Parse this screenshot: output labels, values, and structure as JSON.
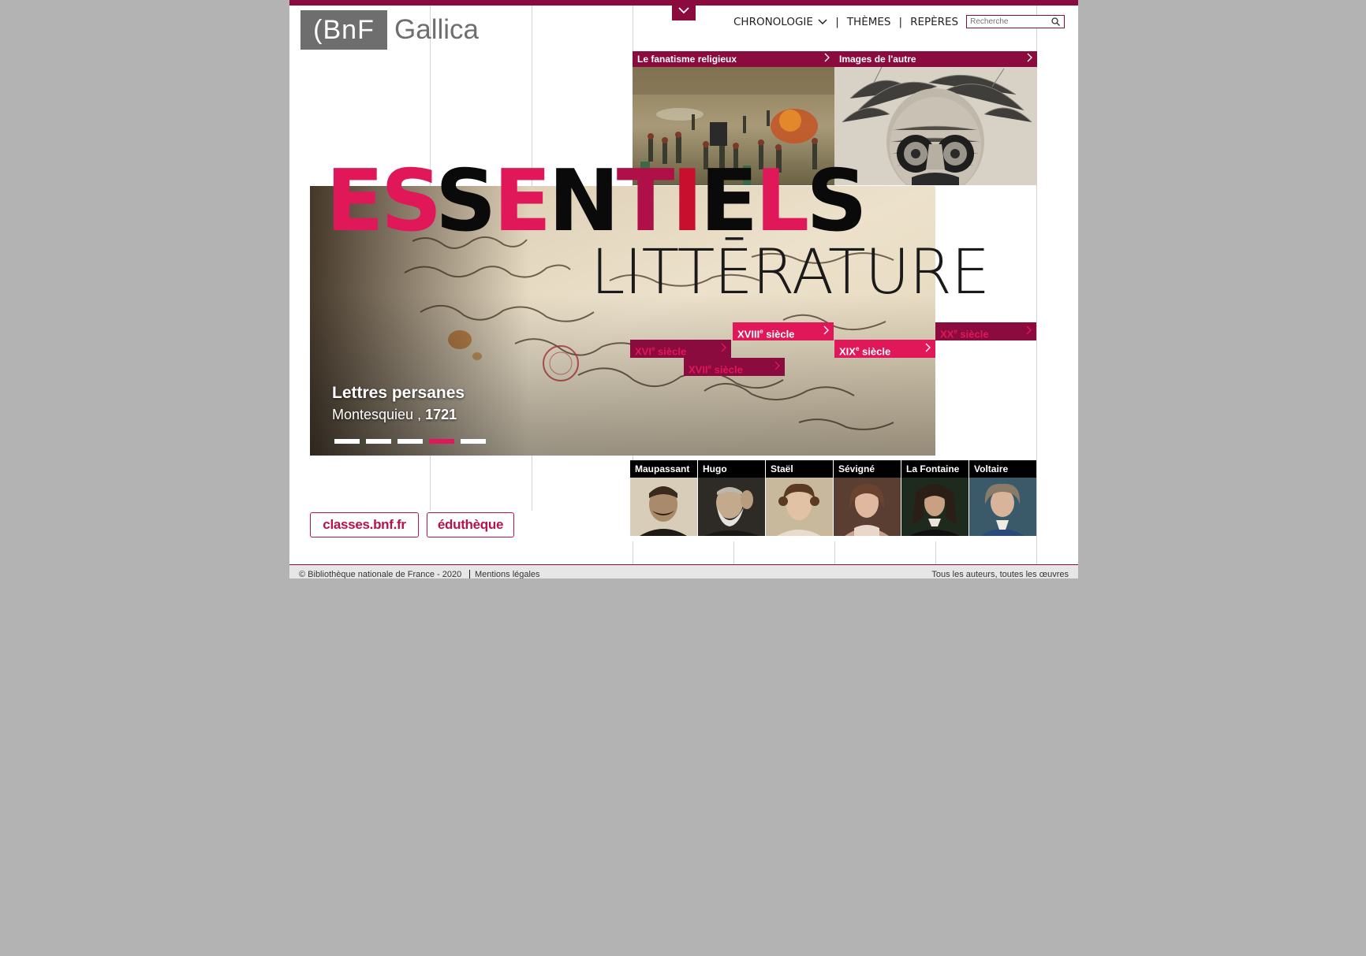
{
  "header": {
    "logo_bnf": "(BnF",
    "logo_gallica": "Gallica",
    "nav": {
      "chronologie": "CHRONOLOGIE",
      "themes": "THÈMES",
      "reperes": "REPÈRES",
      "separator": "|"
    },
    "search": {
      "placeholder": "Recherche"
    }
  },
  "tiles": [
    {
      "label": "Le fanatisme religieux"
    },
    {
      "label": "Images de l'autre"
    }
  ],
  "hero": {
    "title_letters": [
      "E",
      "S",
      "S",
      "E",
      "N",
      "T",
      "I",
      "E",
      "L",
      "S"
    ],
    "subtitle": "LITTĒRATURE",
    "caption_title": "Lettres persanes",
    "caption_author": "Montesquieu ,",
    "caption_year": "1721",
    "active_slide": 4,
    "slide_count": 5
  },
  "centuries": [
    {
      "roman": "XVI",
      "sup": "e",
      "label": "siècle"
    },
    {
      "roman": "XVII",
      "sup": "e",
      "label": "siècle"
    },
    {
      "roman": "XVIII",
      "sup": "e",
      "label": "siècle"
    },
    {
      "roman": "XIX",
      "sup": "e",
      "label": "siècle"
    },
    {
      "roman": "XX",
      "sup": "e",
      "label": "siècle"
    }
  ],
  "authors": [
    "Maupassant",
    "Hugo",
    "Staël",
    "Sévigné",
    "La Fontaine",
    "Voltaire"
  ],
  "partners": {
    "classes": "classes.bnf.fr",
    "edutheque": "éduthèque"
  },
  "footer": {
    "copyright": "© Bibliothèque nationale de France - 2020",
    "legal": "Mentions légales",
    "all_authors": "Tous les auteurs, toutes les œuvres"
  },
  "colors": {
    "brand": "#8c0b3e",
    "pink": "#e0185a",
    "crimson": "#c8102e",
    "black": "#0a0a0a"
  }
}
